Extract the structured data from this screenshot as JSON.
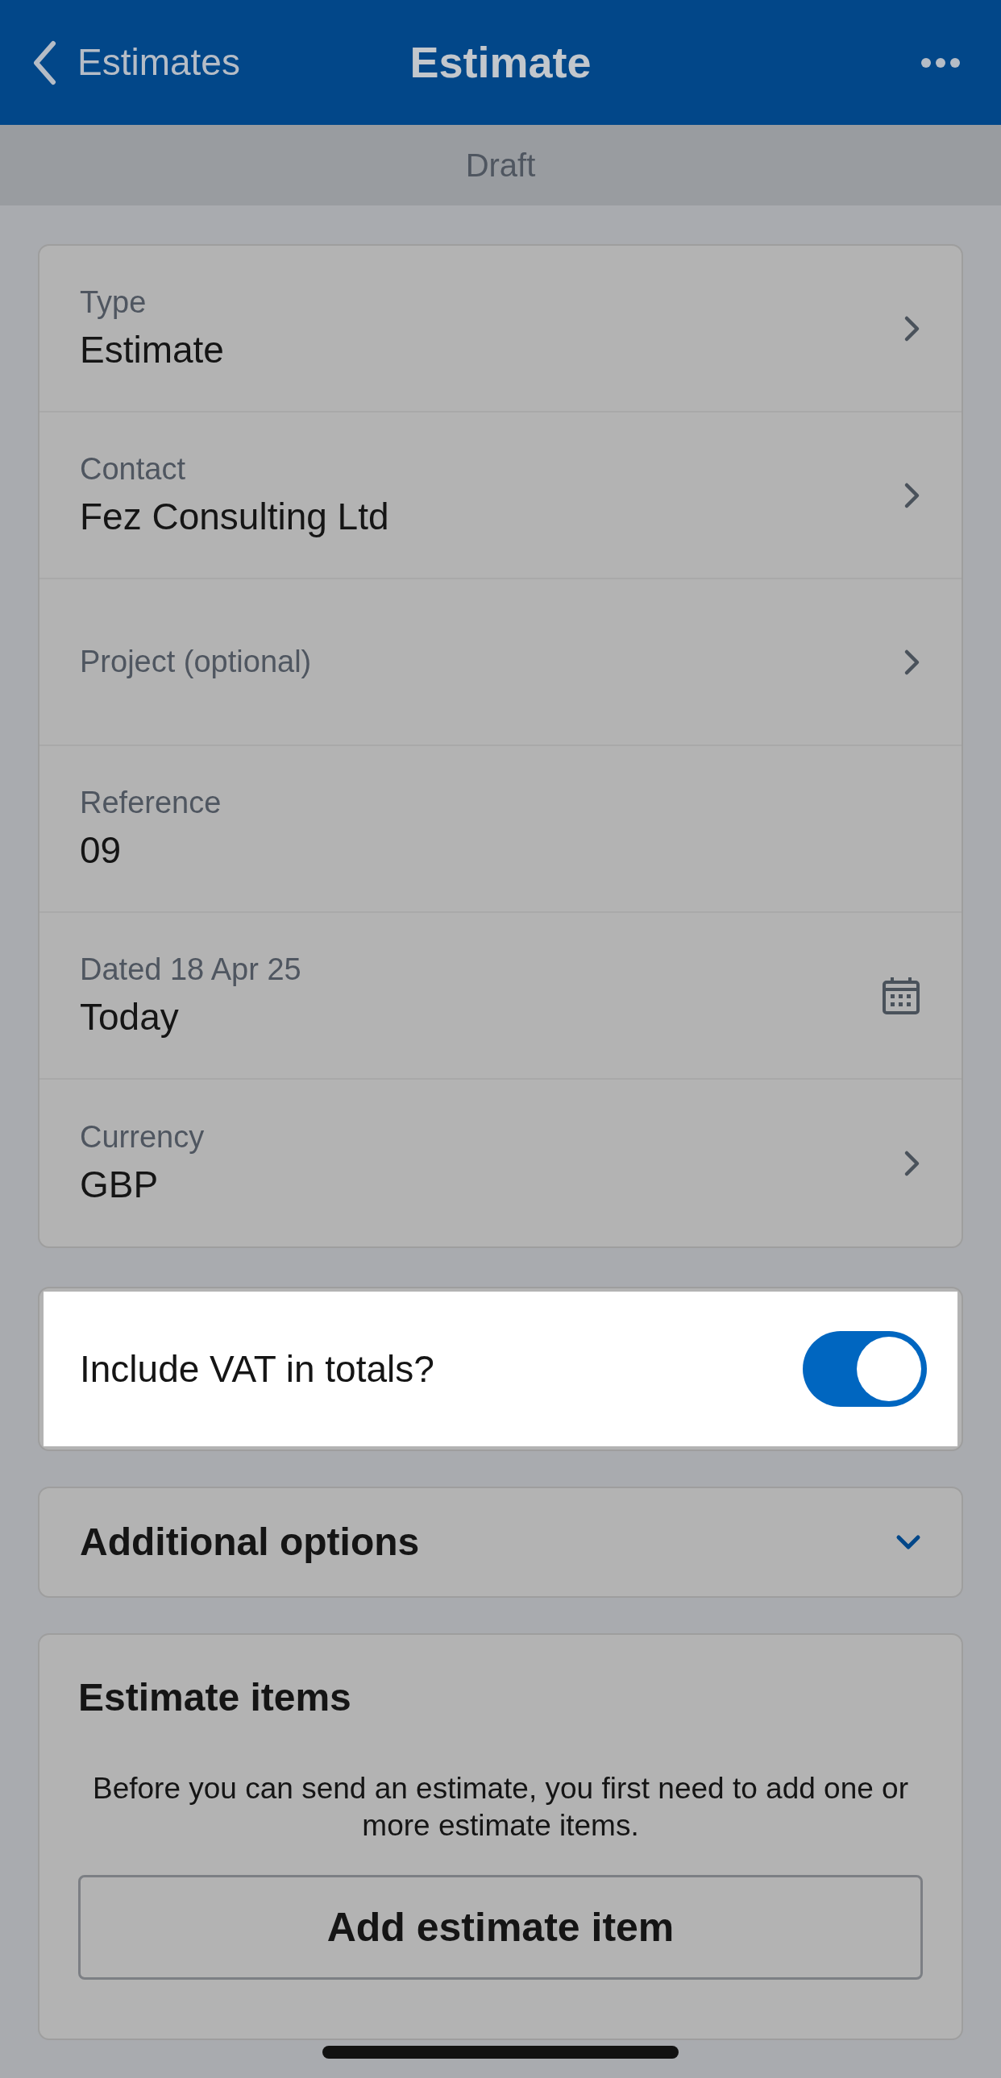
{
  "nav_bar": {
    "back_label": "Estimates",
    "title": "Estimate"
  },
  "status_banner": "Draft",
  "fields": [
    {
      "kind": "nav",
      "label": "Type",
      "value": "Estimate"
    },
    {
      "kind": "nav",
      "label": "Contact",
      "value": "Fez Consulting Ltd"
    },
    {
      "kind": "nav",
      "label": "Project (optional)"
    },
    {
      "kind": "text",
      "label": "Reference",
      "value": "09"
    },
    {
      "kind": "date",
      "label": "Dated 18 Apr 25",
      "value": "Today"
    },
    {
      "kind": "nav",
      "label": "Currency",
      "value": "GBP"
    }
  ],
  "vat_toggle": {
    "label": "Include VAT in totals?",
    "on": true
  },
  "additional_options": {
    "title": "Additional options",
    "expanded": false
  },
  "estimate_items": {
    "title": "Estimate items",
    "message": "Before you can send an estimate, you first need to add one or more estimate items.",
    "button": "Add estimate item"
  }
}
